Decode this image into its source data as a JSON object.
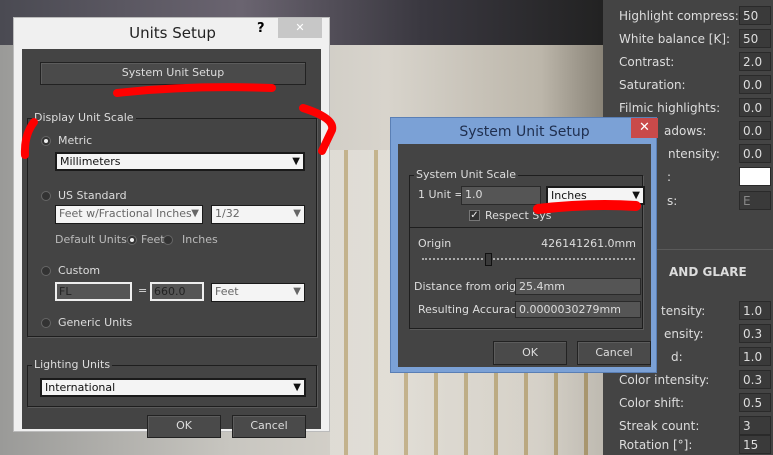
{
  "units_setup": {
    "title": "Units Setup",
    "help": "?",
    "close": "✕",
    "system_unit_setup_button": "System Unit Setup",
    "display_unit_scale": {
      "label": "Display Unit Scale",
      "metric": "Metric",
      "metric_unit": "Millimeters",
      "us_standard": "US Standard",
      "us_unit": "Feet w/Fractional Inches",
      "us_fraction": "1/32",
      "default_units_label": "Default Units:",
      "feet": "Feet",
      "inches": "Inches",
      "custom": "Custom",
      "custom_name": "FL",
      "equals": "=",
      "custom_value": "660.0",
      "custom_unit": "Feet",
      "generic": "Generic Units",
      "selected": "Metric"
    },
    "lighting_units": {
      "label": "Lighting Units",
      "value": "International"
    },
    "ok": "OK",
    "cancel": "Cancel"
  },
  "system_unit_setup": {
    "title": "System Unit Setup",
    "close": "✕",
    "scale_label": "System Unit Scale",
    "unit_label": "1 Unit =",
    "unit_value": "1.0",
    "unit_type": "Inches",
    "respect_label": "Respect Sys",
    "respect_checked": true,
    "origin_label": "Origin",
    "origin_value": "426141261.0mm",
    "distance_label": "Distance from origin:",
    "distance_value": "25.4mm",
    "accuracy_label": "Resulting Accuracy:",
    "accuracy_value": "0.0000030279mm",
    "ok": "OK",
    "cancel": "Cancel"
  },
  "right_panel": {
    "rows": [
      {
        "label": "Highlight compress:",
        "value": "50"
      },
      {
        "label": "White balance [K]:",
        "value": "50"
      },
      {
        "label": "Contrast:",
        "value": "2.0"
      },
      {
        "label": "Saturation:",
        "value": "0.0"
      },
      {
        "label": "Filmic highlights:",
        "value": "0.0"
      },
      {
        "label": "adows:",
        "value": "0.0"
      },
      {
        "label": "ntensity:",
        "value": "0.0"
      },
      {
        "label": ":",
        "value": ""
      },
      {
        "label": "s:",
        "value": "E"
      }
    ],
    "section": "AND GLARE",
    "rows2": [
      {
        "label": "tensity:",
        "value": "1.0"
      },
      {
        "label": "ensity:",
        "value": "0.3"
      },
      {
        "label": "d:",
        "value": "1.0"
      },
      {
        "label": "Color intensity:",
        "value": "0.3"
      },
      {
        "label": "Color shift:",
        "value": "0.5"
      },
      {
        "label": "Streak count:",
        "value": "3"
      },
      {
        "label": "Rotation [°]:",
        "value": "15"
      }
    ]
  }
}
